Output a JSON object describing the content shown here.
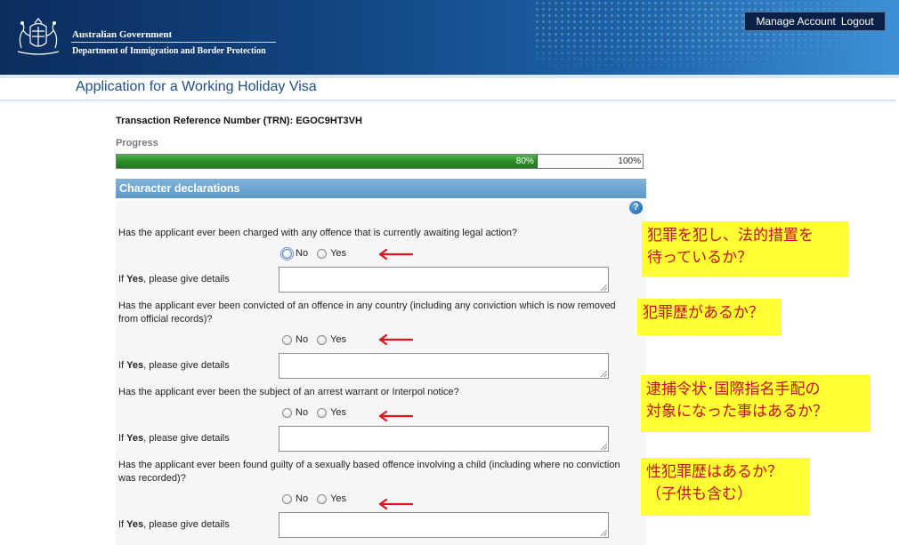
{
  "header": {
    "gov_name": "Australian Government",
    "dept_name": "Department of Immigration and Border Protection",
    "manage_account": "Manage Account",
    "logout": "Logout"
  },
  "page": {
    "title": "Application for a Working Holiday Visa",
    "trn": "Transaction Reference Number (TRN): EGOC9HT3VH"
  },
  "progress": {
    "label": "Progress",
    "current_label": "80%",
    "max_label": "100%",
    "value_percent": 80
  },
  "section": {
    "title": "Character declarations",
    "help_icon": "?"
  },
  "options": {
    "no": "No",
    "yes": "Yes"
  },
  "details": {
    "if": "If ",
    "yes": "Yes",
    "rest": ", please give details"
  },
  "questions": [
    {
      "text": "Has the applicant ever been charged with any offence that is currently awaiting legal action?",
      "selected": "none"
    },
    {
      "text": "Has the applicant ever been convicted of an offence in any country (including any conviction which is now removed from official records)?",
      "selected": "none"
    },
    {
      "text": "Has the applicant ever been the subject of an arrest warrant or Interpol notice?",
      "selected": "none"
    },
    {
      "text": "Has the applicant ever been found guilty of a sexually based offence involving a child (including where no conviction was recorded)?",
      "selected": "none"
    }
  ],
  "annotations": {
    "note1_line1": "犯罪を犯し、法的措置を",
    "note1_line2": "待っているか？",
    "note2": "犯罪歴があるか？",
    "note3_line1": "逮捕令状･国際指名手配の",
    "note3_line2": "対象になった事はあるか？",
    "note4_line1": "性犯罪歴はあるか？",
    "note4_line2": "（子供も含む）",
    "arrow_color": "#e0141e",
    "note_bg": "#ffff33",
    "note_text_color": "#c4121d"
  }
}
